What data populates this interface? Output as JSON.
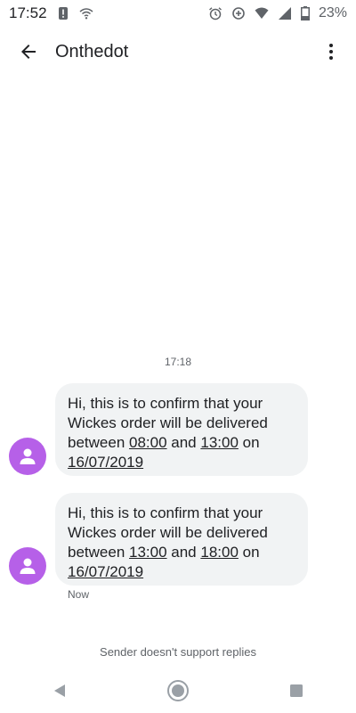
{
  "status_bar": {
    "time": "17:52",
    "battery_percent": "23%",
    "icons": [
      "alert-icon",
      "wifi-icon",
      "alarm-icon",
      "data-saver-icon",
      "wifi-signal-icon",
      "cell-signal-icon",
      "battery-icon"
    ]
  },
  "app_bar": {
    "title": "Onthedot",
    "back_icon": "arrow-back-icon",
    "menu_icon": "more-vertical-icon"
  },
  "conversation": {
    "timestamp": "17:18",
    "messages": [
      {
        "pre": "Hi, this is to confirm that your Wickes order will be delivered between ",
        "time_from": "08:00",
        "and": " and ",
        "time_to": "13:00",
        "on": " on ",
        "date": "16/07/2019"
      },
      {
        "pre": "Hi, this is to confirm that your Wickes order will be delivered between ",
        "time_from": "13:00",
        "and": " and ",
        "time_to": "18:00",
        "on": " on ",
        "date": "16/07/2019"
      }
    ],
    "last_message_time": "Now",
    "footer_note": "Sender doesn't support replies"
  },
  "nav_bar": {
    "icons": [
      "back-triangle-icon",
      "home-circle-icon",
      "recents-square-icon"
    ]
  },
  "colors": {
    "avatar": "#b660e8",
    "bubble": "#f1f3f4",
    "text_primary": "#202124",
    "text_secondary": "#5f6368"
  }
}
